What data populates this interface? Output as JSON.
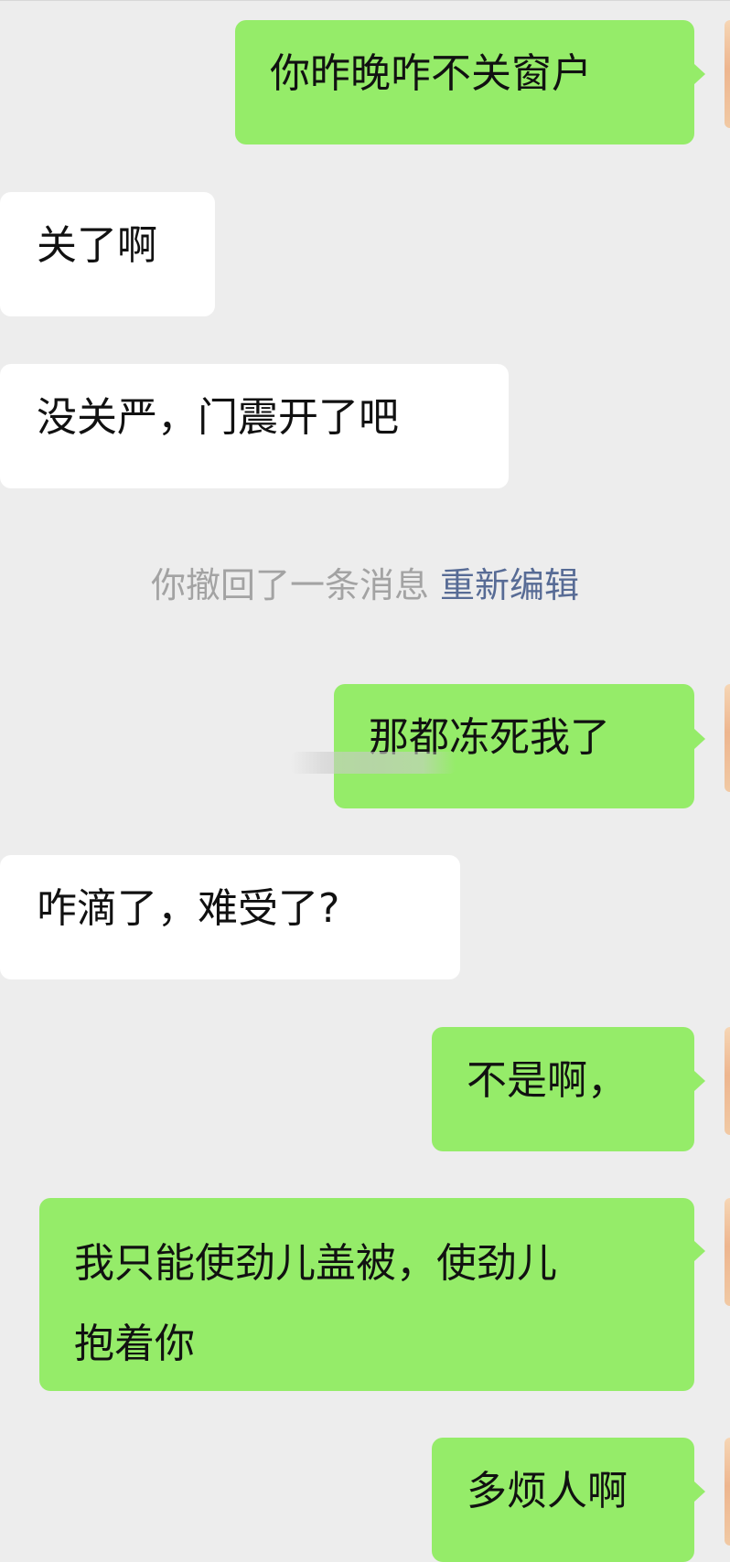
{
  "messages": [
    {
      "from": "me",
      "text": "你昨晚咋不关窗户"
    },
    {
      "from": "them",
      "text": "关了啊"
    },
    {
      "from": "them",
      "text": "没关严，门震开了吧"
    },
    {
      "from": "me",
      "text": "那都冻死我了"
    },
    {
      "from": "them",
      "text": "咋滴了，难受了?"
    },
    {
      "from": "me",
      "text": "不是啊，"
    },
    {
      "from": "me",
      "line1": "我只能使劲儿盖被，使劲儿",
      "line2": "抱着你"
    },
    {
      "from": "me",
      "text": "多烦人啊"
    }
  ],
  "system_notice": {
    "text": "你撤回了一条消息",
    "action": "重新编辑"
  },
  "colors": {
    "background": "#ededed",
    "my_bubble": "#95ec69",
    "their_bubble": "#ffffff",
    "link": "#576b95",
    "system_text": "#a3a3a3"
  }
}
